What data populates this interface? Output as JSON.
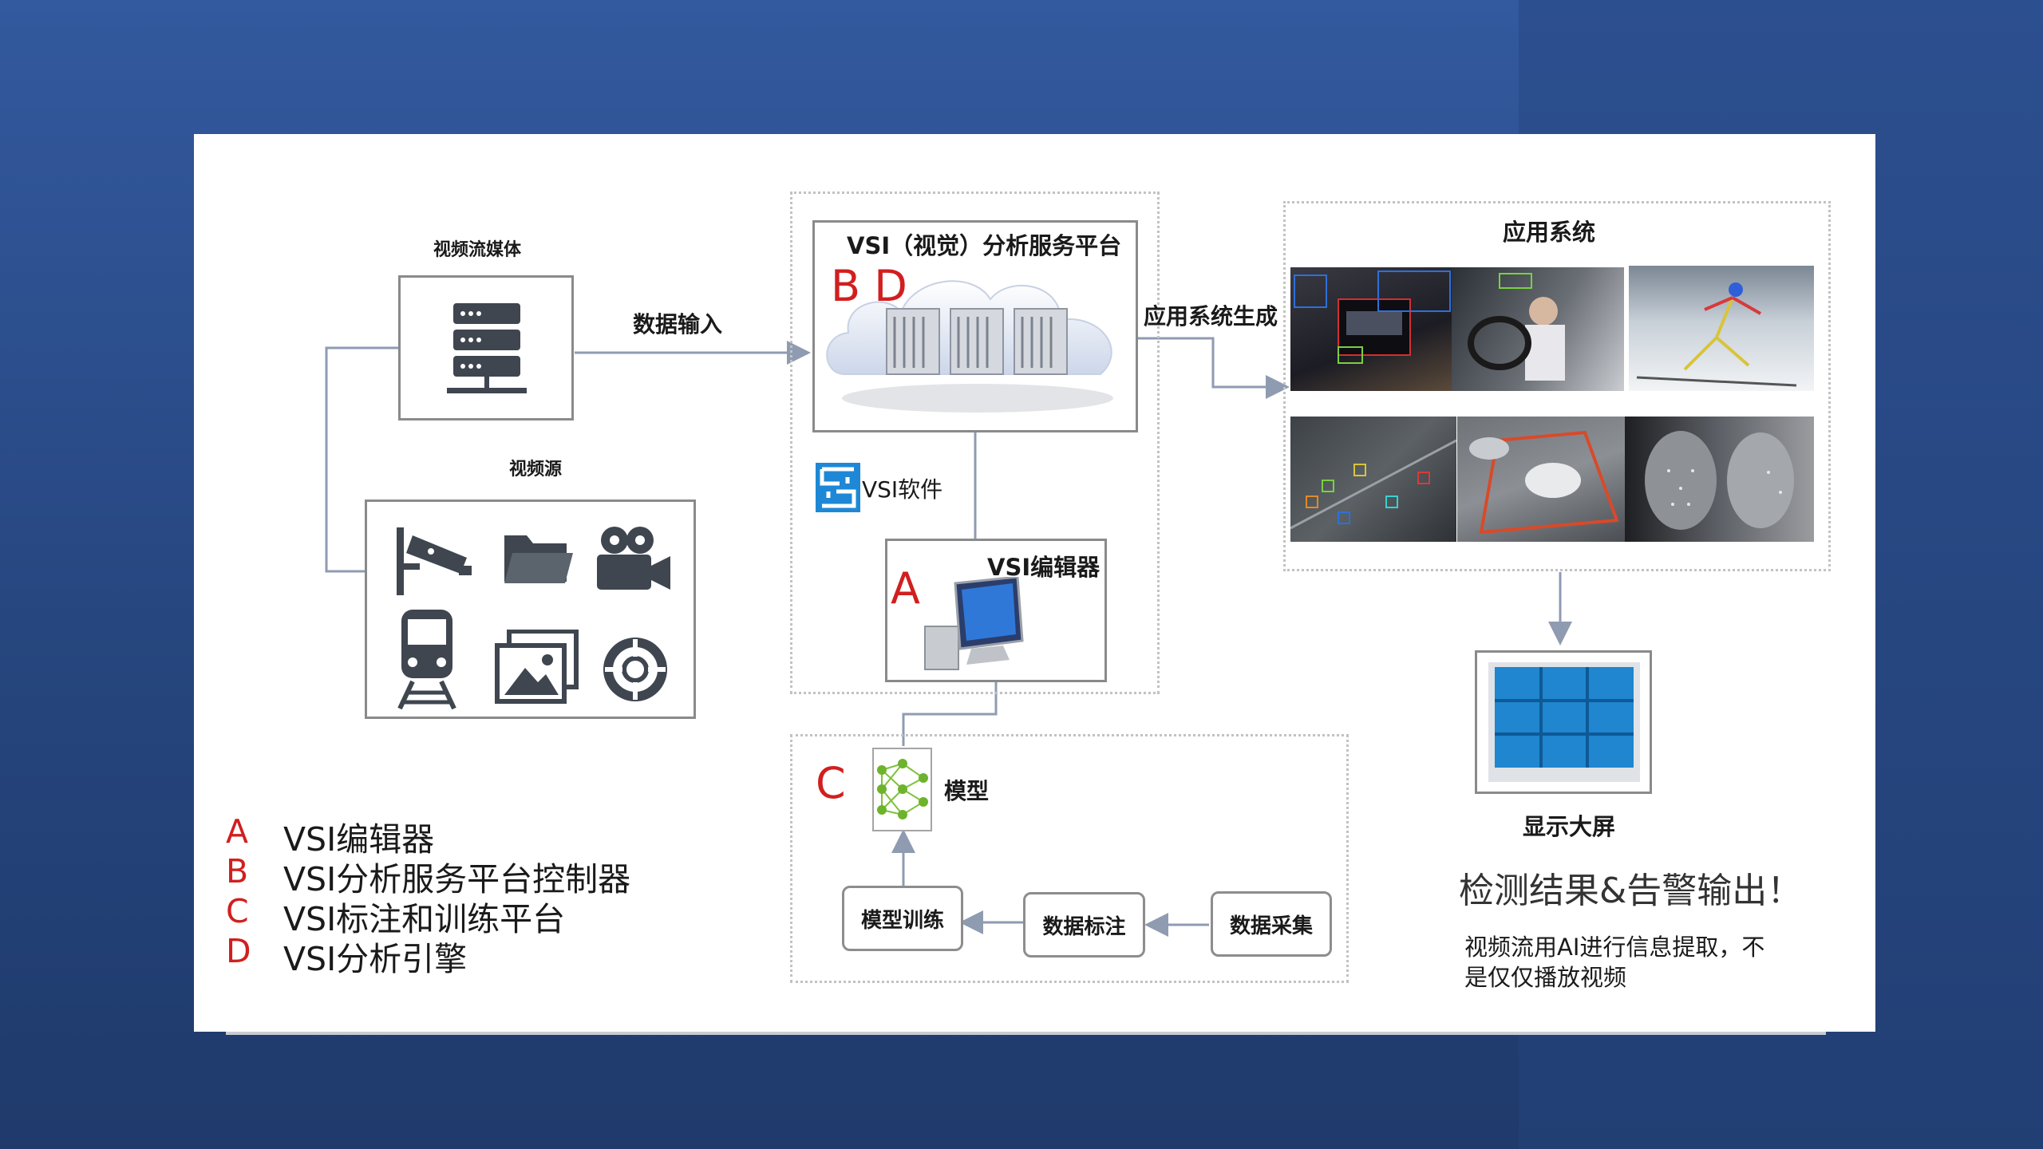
{
  "nodes": {
    "video_stream_media": "视频流媒体",
    "video_source": "视频源",
    "data_input": "数据输入",
    "platform_title": "VSI（视觉）分析服务平台",
    "platform_letters": "B D",
    "vsi_software": "VSI软件",
    "vsi_editor": "VSI编辑器",
    "editor_letter": "A",
    "app_generate": "应用系统生成",
    "app_system": "应用系统",
    "display": "显示大屏",
    "model": "模型",
    "model_letter": "C",
    "model_training": "模型训练",
    "data_labeling": "数据标注",
    "data_collection": "数据采集"
  },
  "output": {
    "headline": "检测结果&告警输出！",
    "note": "视频流用AI进行信息提取，不是仅仅播放视频"
  },
  "legend": [
    {
      "key": "A",
      "text": "VSI编辑器"
    },
    {
      "key": "B",
      "text": "VSI分析服务平台控制器"
    },
    {
      "key": "C",
      "text": "VSI标注和训练平台"
    },
    {
      "key": "D",
      "text": "VSI分析引擎"
    }
  ],
  "icons": [
    "server-icon",
    "surveillance-camera-icon",
    "folder-icon",
    "movie-camera-icon",
    "train-icon",
    "image-gallery-icon",
    "lifebuoy-icon",
    "cloud-servers-icon",
    "vsi-logo-icon",
    "computer-monitor-icon",
    "neural-network-icon",
    "video-wall-icon"
  ],
  "colors": {
    "accent_red": "#d11f1f",
    "arrow_gray": "#8f9bb1",
    "background_blue": "#2c4f8f"
  }
}
